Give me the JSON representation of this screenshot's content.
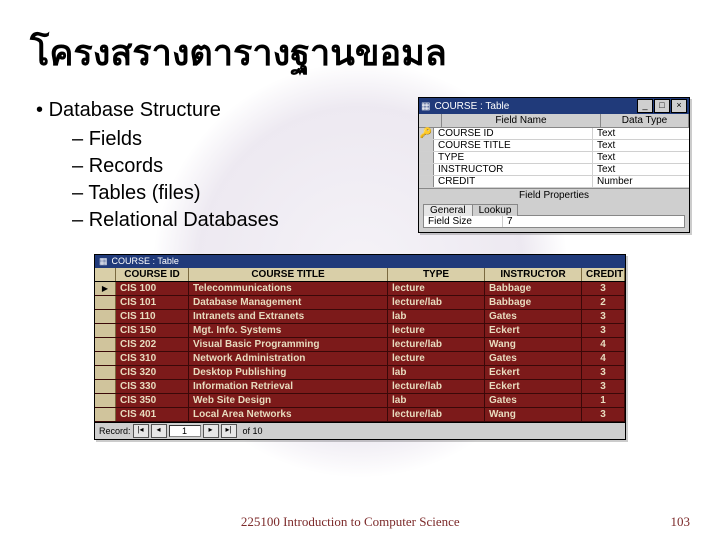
{
  "title": "โครงสรางตารางฐานขอมล",
  "bullets": {
    "l1": "Database Structure",
    "l2": [
      "Fields",
      "Records",
      "Tables (files)",
      "Relational Databases"
    ]
  },
  "design_window": {
    "titlebar": "COURSE : Table",
    "columns": {
      "sel": "",
      "name": "Field Name",
      "type": "Data Type"
    },
    "rows": [
      {
        "key": "🔑",
        "name": "COURSE ID",
        "type": "Text"
      },
      {
        "key": "",
        "name": "COURSE TITLE",
        "type": "Text"
      },
      {
        "key": "",
        "name": "TYPE",
        "type": "Text"
      },
      {
        "key": "",
        "name": "INSTRUCTOR",
        "type": "Text"
      },
      {
        "key": "",
        "name": "CREDIT",
        "type": "Number"
      }
    ],
    "props_header": "Field Properties",
    "tabs": [
      "General",
      "Lookup"
    ],
    "prop": {
      "label": "Field Size",
      "value": "7"
    }
  },
  "datasheet": {
    "titlebar": "COURSE : Table",
    "columns": [
      "COURSE ID",
      "COURSE TITLE",
      "TYPE",
      "INSTRUCTOR",
      "CREDIT"
    ],
    "rows": [
      [
        "CIS 100",
        "Telecommunications",
        "lecture",
        "Babbage",
        "3"
      ],
      [
        "CIS 101",
        "Database Management",
        "lecture/lab",
        "Babbage",
        "2"
      ],
      [
        "CIS 110",
        "Intranets and Extranets",
        "lab",
        "Gates",
        "3"
      ],
      [
        "CIS 150",
        "Mgt. Info. Systems",
        "lecture",
        "Eckert",
        "3"
      ],
      [
        "CIS 202",
        "Visual Basic Programming",
        "lecture/lab",
        "Wang",
        "4"
      ],
      [
        "CIS 310",
        "Network Administration",
        "lecture",
        "Gates",
        "4"
      ],
      [
        "CIS 320",
        "Desktop Publishing",
        "lab",
        "Eckert",
        "3"
      ],
      [
        "CIS 330",
        "Information Retrieval",
        "lecture/lab",
        "Eckert",
        "3"
      ],
      [
        "CIS 350",
        "Web Site Design",
        "lab",
        "Gates",
        "1"
      ],
      [
        "CIS 401",
        "Local Area Networks",
        "lecture/lab",
        "Wang",
        "3"
      ]
    ],
    "nav": {
      "label": "Record:",
      "pos": "1",
      "of": "of 10"
    }
  },
  "footer": {
    "text": "225100 Introduction to Computer Science",
    "page": "103"
  },
  "chart_data": {
    "type": "table",
    "title": "COURSE : Table",
    "columns": [
      "COURSE ID",
      "COURSE TITLE",
      "TYPE",
      "INSTRUCTOR",
      "CREDIT"
    ],
    "rows": [
      [
        "CIS 100",
        "Telecommunications",
        "lecture",
        "Babbage",
        3
      ],
      [
        "CIS 101",
        "Database Management",
        "lecture/lab",
        "Babbage",
        2
      ],
      [
        "CIS 110",
        "Intranets and Extranets",
        "lab",
        "Gates",
        3
      ],
      [
        "CIS 150",
        "Mgt. Info. Systems",
        "lecture",
        "Eckert",
        3
      ],
      [
        "CIS 202",
        "Visual Basic Programming",
        "lecture/lab",
        "Wang",
        4
      ],
      [
        "CIS 310",
        "Network Administration",
        "lecture",
        "Gates",
        4
      ],
      [
        "CIS 320",
        "Desktop Publishing",
        "lab",
        "Eckert",
        3
      ],
      [
        "CIS 330",
        "Information Retrieval",
        "lecture/lab",
        "Eckert",
        3
      ],
      [
        "CIS 350",
        "Web Site Design",
        "lab",
        "Gates",
        1
      ],
      [
        "CIS 401",
        "Local Area Networks",
        "lecture/lab",
        "Wang",
        3
      ]
    ]
  }
}
